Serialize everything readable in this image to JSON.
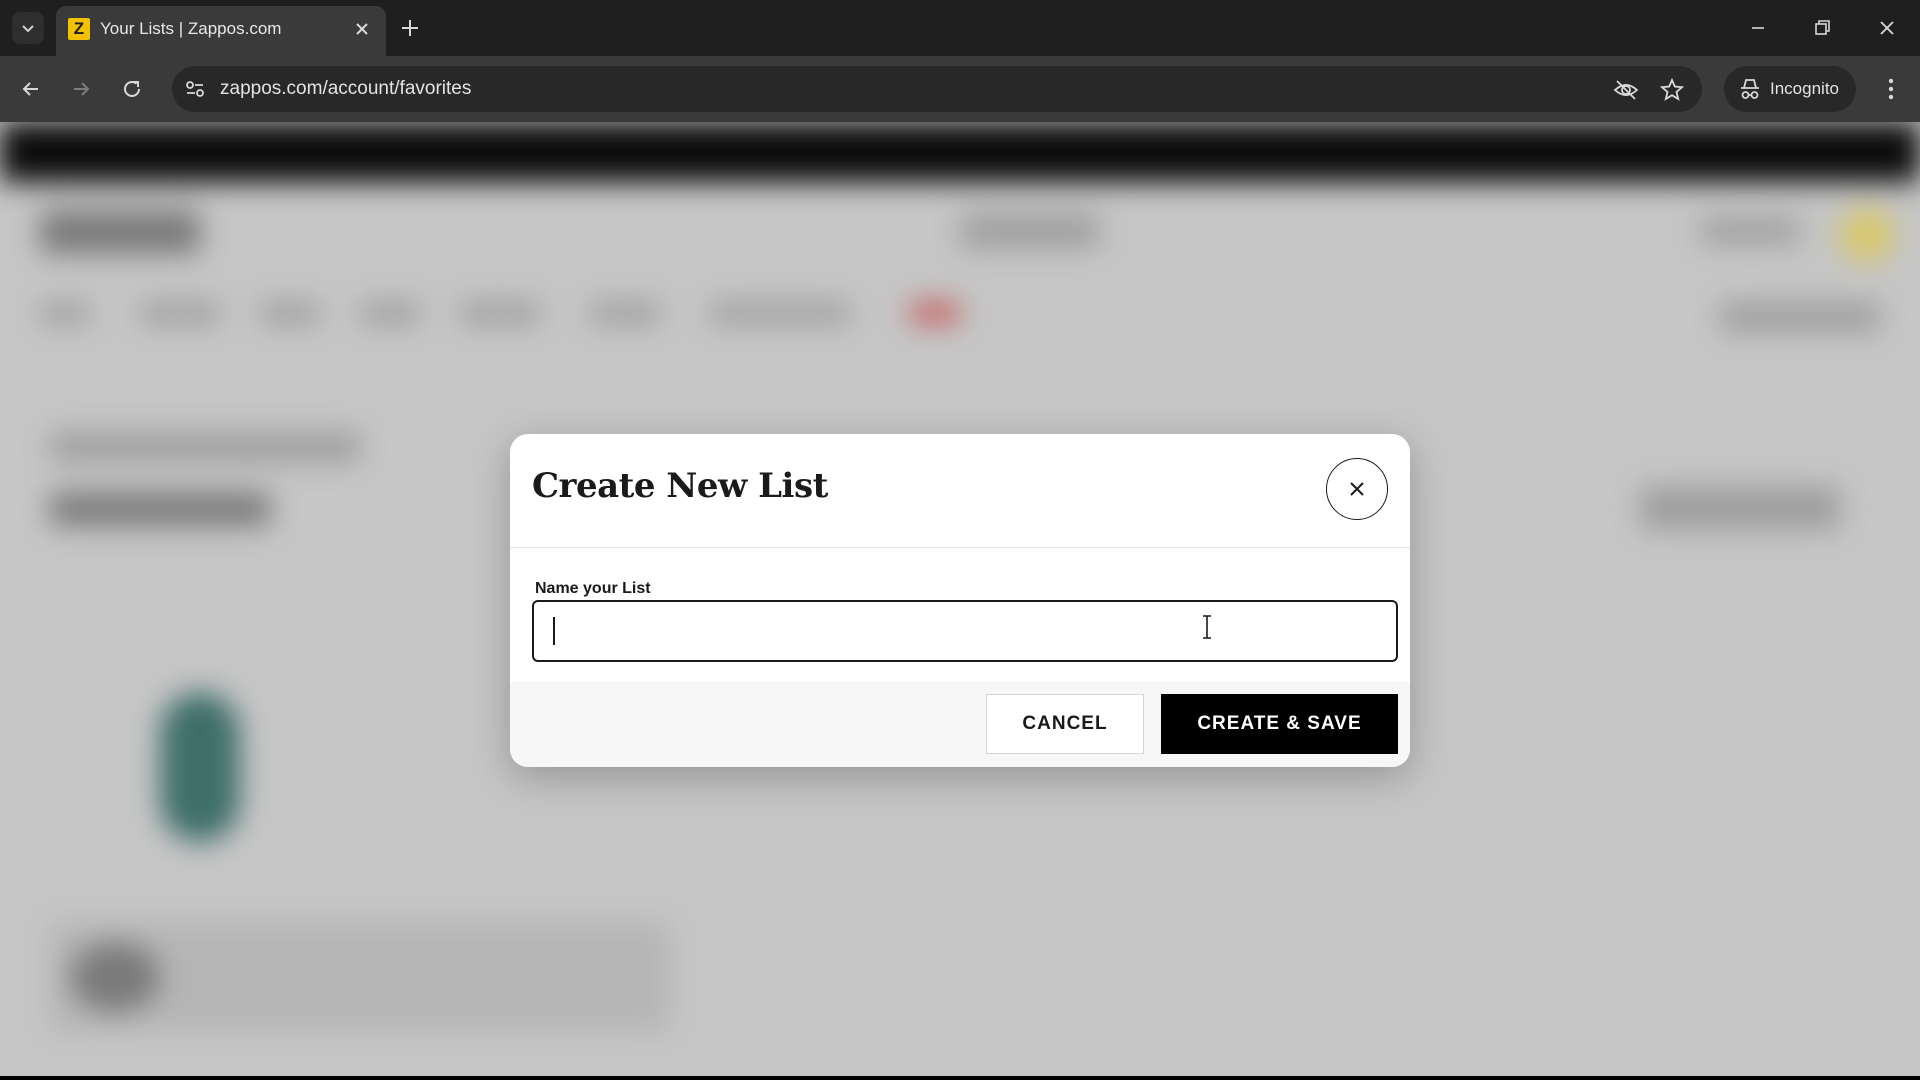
{
  "browser": {
    "tab_title": "Your Lists | Zappos.com",
    "favicon_letter": "Z",
    "url": "zappos.com/account/favorites",
    "incognito_label": "Incognito"
  },
  "icons": {
    "tab_list": "chevron-down-icon",
    "tab_close": "close-icon",
    "new_tab": "plus-icon",
    "minimize": "minimize-icon",
    "restore": "restore-icon",
    "window_close": "close-icon",
    "back": "arrow-left-icon",
    "forward": "arrow-right-icon",
    "reload": "reload-icon",
    "site_info": "tune-icon",
    "eye_off": "eye-off-icon",
    "bookmark": "star-icon",
    "incognito": "incognito-icon",
    "menu": "kebab-icon",
    "dialog_close": "close-icon"
  },
  "modal": {
    "title": "Create New List",
    "field_label": "Name your List",
    "input_value": "",
    "cancel_label": "CANCEL",
    "create_label": "CREATE & SAVE"
  },
  "colors": {
    "browser_dark": "#1f1f1f",
    "toolbar": "#3a3a3a",
    "overlay": "#c6c6c6",
    "primary_button": "#000000",
    "favicon": "#f2c200"
  }
}
